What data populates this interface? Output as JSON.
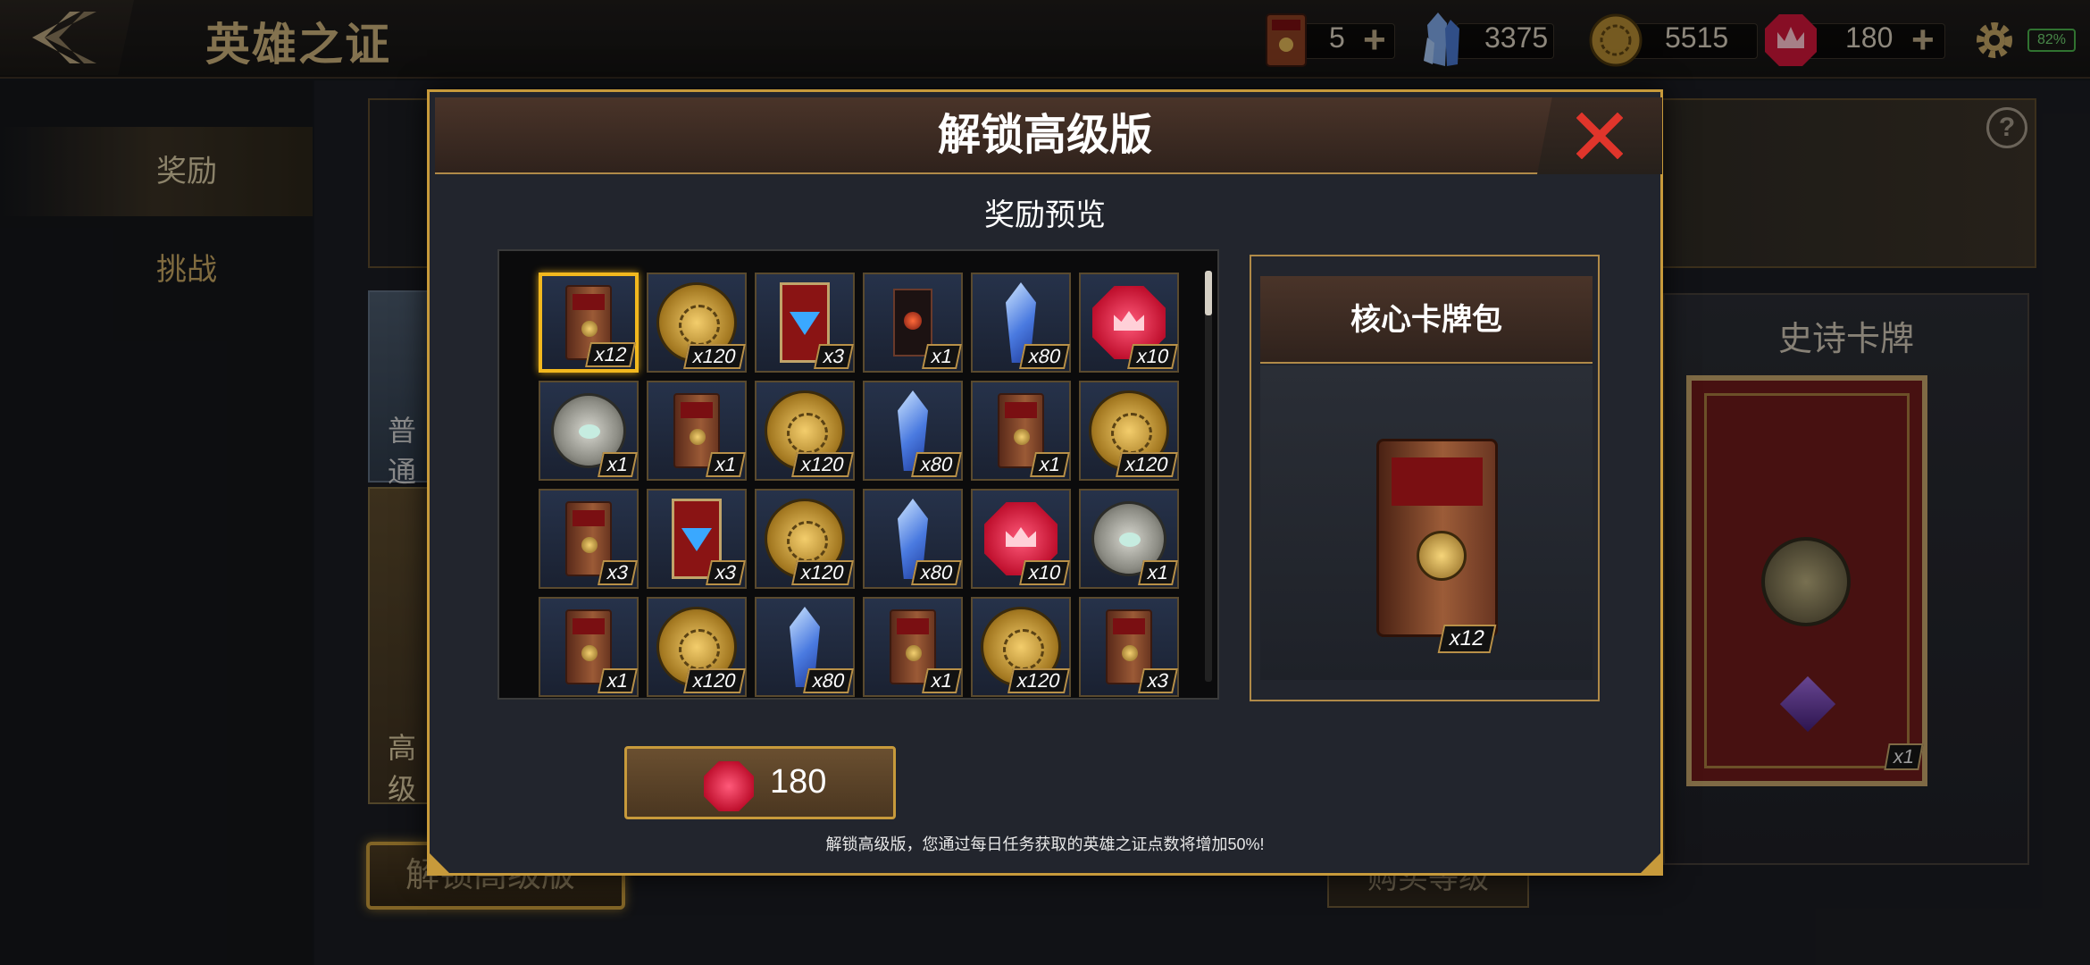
{
  "header": {
    "title": "英雄之证",
    "back_icon": "back-arrow-icon",
    "resources": [
      {
        "name": "card-pack",
        "icon": "card-pack-icon",
        "value": "5",
        "has_plus": true
      },
      {
        "name": "crystal",
        "icon": "crystal-icon",
        "value": "3375",
        "has_plus": false
      },
      {
        "name": "gold-coin",
        "icon": "gold-coin-icon",
        "value": "5515",
        "has_plus": false
      },
      {
        "name": "ruby",
        "icon": "ruby-icon",
        "value": "180",
        "has_plus": true
      }
    ],
    "settings_icon": "gear-icon",
    "battery": "82%"
  },
  "sidebar": {
    "items": [
      {
        "label": "奖励",
        "active": true
      },
      {
        "label": "挑战",
        "active": false
      }
    ]
  },
  "background": {
    "normal_card_label": "普通",
    "advanced_card_label": "高级",
    "unlock_button_label": "解锁高级版",
    "buy_level_button_label": "购买等级",
    "epic_panel_title": "史诗卡牌",
    "epic_card_qty": "x1",
    "help_icon": "?"
  },
  "modal": {
    "title": "解锁高级版",
    "close_icon": "close-x-icon",
    "preview_title": "奖励预览",
    "items": [
      {
        "type": "pack",
        "qty": "x12",
        "selected": true
      },
      {
        "type": "coin",
        "qty": "x120"
      },
      {
        "type": "redcard",
        "qty": "x3"
      },
      {
        "type": "darkcard",
        "qty": "x1"
      },
      {
        "type": "crystal",
        "qty": "x80"
      },
      {
        "type": "ruby",
        "qty": "x10"
      },
      {
        "type": "silver",
        "qty": "x1"
      },
      {
        "type": "pack",
        "qty": "x1"
      },
      {
        "type": "coin",
        "qty": "x120"
      },
      {
        "type": "crystal",
        "qty": "x80"
      },
      {
        "type": "pack",
        "qty": "x1"
      },
      {
        "type": "coin",
        "qty": "x120"
      },
      {
        "type": "pack",
        "qty": "x3"
      },
      {
        "type": "redcard",
        "qty": "x3"
      },
      {
        "type": "coin",
        "qty": "x120"
      },
      {
        "type": "crystal",
        "qty": "x80"
      },
      {
        "type": "ruby",
        "qty": "x10"
      },
      {
        "type": "silver",
        "qty": "x1"
      },
      {
        "type": "pack",
        "qty": "x1"
      },
      {
        "type": "coin",
        "qty": "x120"
      },
      {
        "type": "crystal",
        "qty": "x80"
      },
      {
        "type": "pack",
        "qty": "x1"
      },
      {
        "type": "coin",
        "qty": "x120"
      },
      {
        "type": "pack",
        "qty": "x3"
      }
    ],
    "detail": {
      "title": "核心卡牌包",
      "qty": "x12"
    },
    "buy_button": {
      "icon": "ruby-icon",
      "price": "180"
    },
    "footnote": "解锁高级版，您通过每日任务获取的英雄之证点数将增加50%!"
  },
  "colors": {
    "accent_gold": "#c79a3b",
    "close_red": "#e0352b",
    "selected_border": "#f2b81e"
  }
}
